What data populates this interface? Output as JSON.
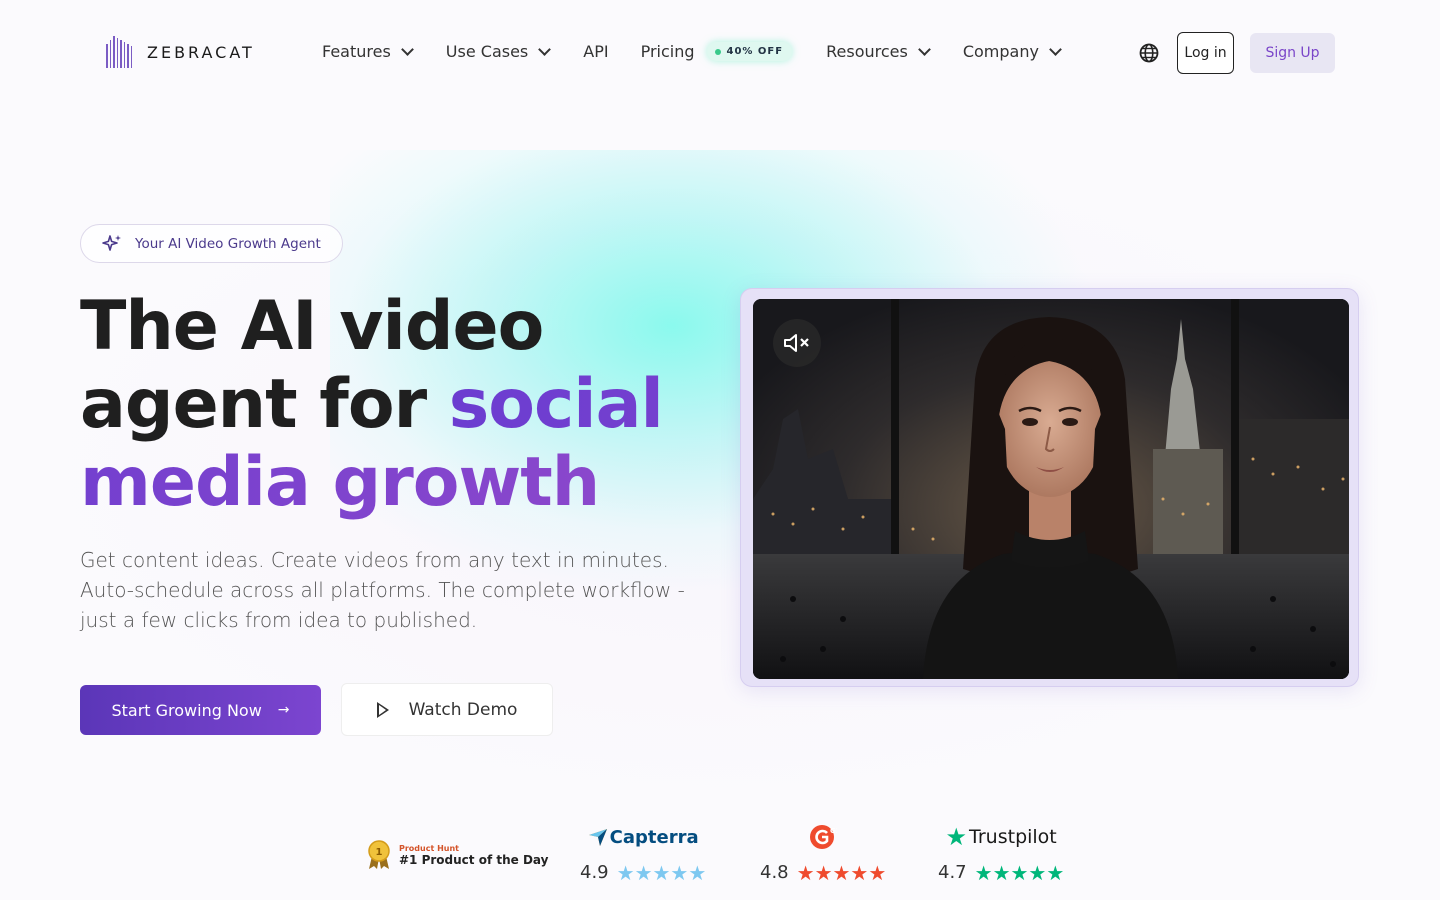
{
  "brand": {
    "name": "ZEBRACAT"
  },
  "nav": {
    "items": [
      {
        "label": "Features",
        "dropdown": true
      },
      {
        "label": "Use Cases",
        "dropdown": true
      },
      {
        "label": "API",
        "dropdown": false
      },
      {
        "label": "Pricing",
        "dropdown": false,
        "badge": "40% OFF"
      },
      {
        "label": "Resources",
        "dropdown": true
      },
      {
        "label": "Company",
        "dropdown": true
      }
    ],
    "login_label": "Log in",
    "signup_label": "Sign Up",
    "language_icon": "globe-icon"
  },
  "hero": {
    "pill_label": "Your AI Video Growth Agent",
    "headline_part1": "The AI video agent for",
    "headline_part2": "social media growth",
    "subtitle": "Get content ideas. Create videos from any text in minutes. Auto-schedule across all platforms. The complete workflow - just a few clicks from idea to published.",
    "primary_cta": "Start Growing Now",
    "secondary_cta": "Watch Demo"
  },
  "video": {
    "mute_icon": "muted-speaker-icon"
  },
  "social_proof": {
    "product_hunt": {
      "kicker": "Product Hunt",
      "title": "#1 Product of the Day",
      "medal_number": "1"
    },
    "ratings": [
      {
        "brand": "Capterra",
        "score": "4.9",
        "stars": 5,
        "color": "#7ec8f0"
      },
      {
        "brand": "G2",
        "score": "4.8",
        "stars": 5,
        "color": "#ef4b2e"
      },
      {
        "brand": "Trustpilot",
        "score": "4.7",
        "stars": 5,
        "color": "#00b67a"
      }
    ]
  },
  "colors": {
    "accent": "#7440d0",
    "primary_button": "#5b36b8",
    "glow": "#78faeb"
  }
}
